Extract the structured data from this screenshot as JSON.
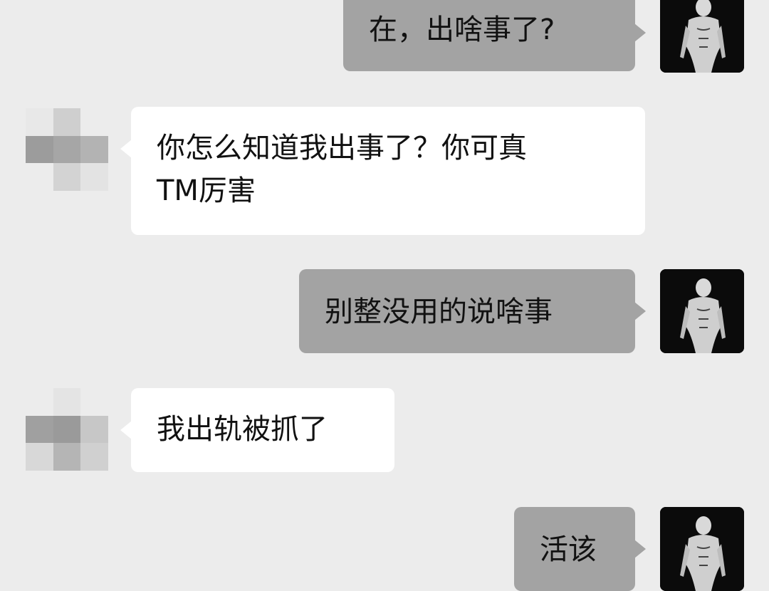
{
  "messages": [
    {
      "id": "m1",
      "side": "out",
      "text": "在，出啥事了?"
    },
    {
      "id": "m2",
      "side": "in",
      "text": "你怎么知道我出事了？你可真\nTM厉害"
    },
    {
      "id": "m3",
      "side": "out",
      "text": "别整没用的说啥事"
    },
    {
      "id": "m4",
      "side": "in",
      "text": "我出轨被抓了"
    },
    {
      "id": "m5",
      "side": "out",
      "text": "活该"
    }
  ],
  "avatars": {
    "self_icon": "shirtless-man-silhouette-icon",
    "contact_icon": "pixelated-blurred-avatar-icon"
  },
  "colors": {
    "background": "#ececec",
    "outgoing_bubble": "#a3a3a3",
    "incoming_bubble": "#ffffff",
    "text": "#111111"
  }
}
